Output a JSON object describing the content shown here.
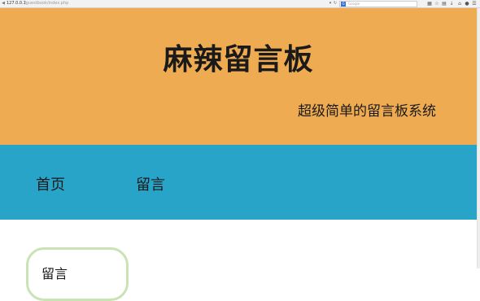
{
  "browser": {
    "url_host": "127.0.0.1",
    "url_path": "/guestbook/index.php",
    "search_placeholder": "Google",
    "search_engine_letter": "G"
  },
  "header": {
    "title": "麻辣留言板",
    "subtitle": "超级简单的留言板系统",
    "bg_color": "#efab51"
  },
  "nav": {
    "bg_color": "#28a4c9",
    "items": [
      {
        "label": "首页"
      },
      {
        "label": "留言"
      }
    ]
  },
  "content": {
    "card_text": "留言",
    "card_border_color": "#c9e3b4"
  }
}
